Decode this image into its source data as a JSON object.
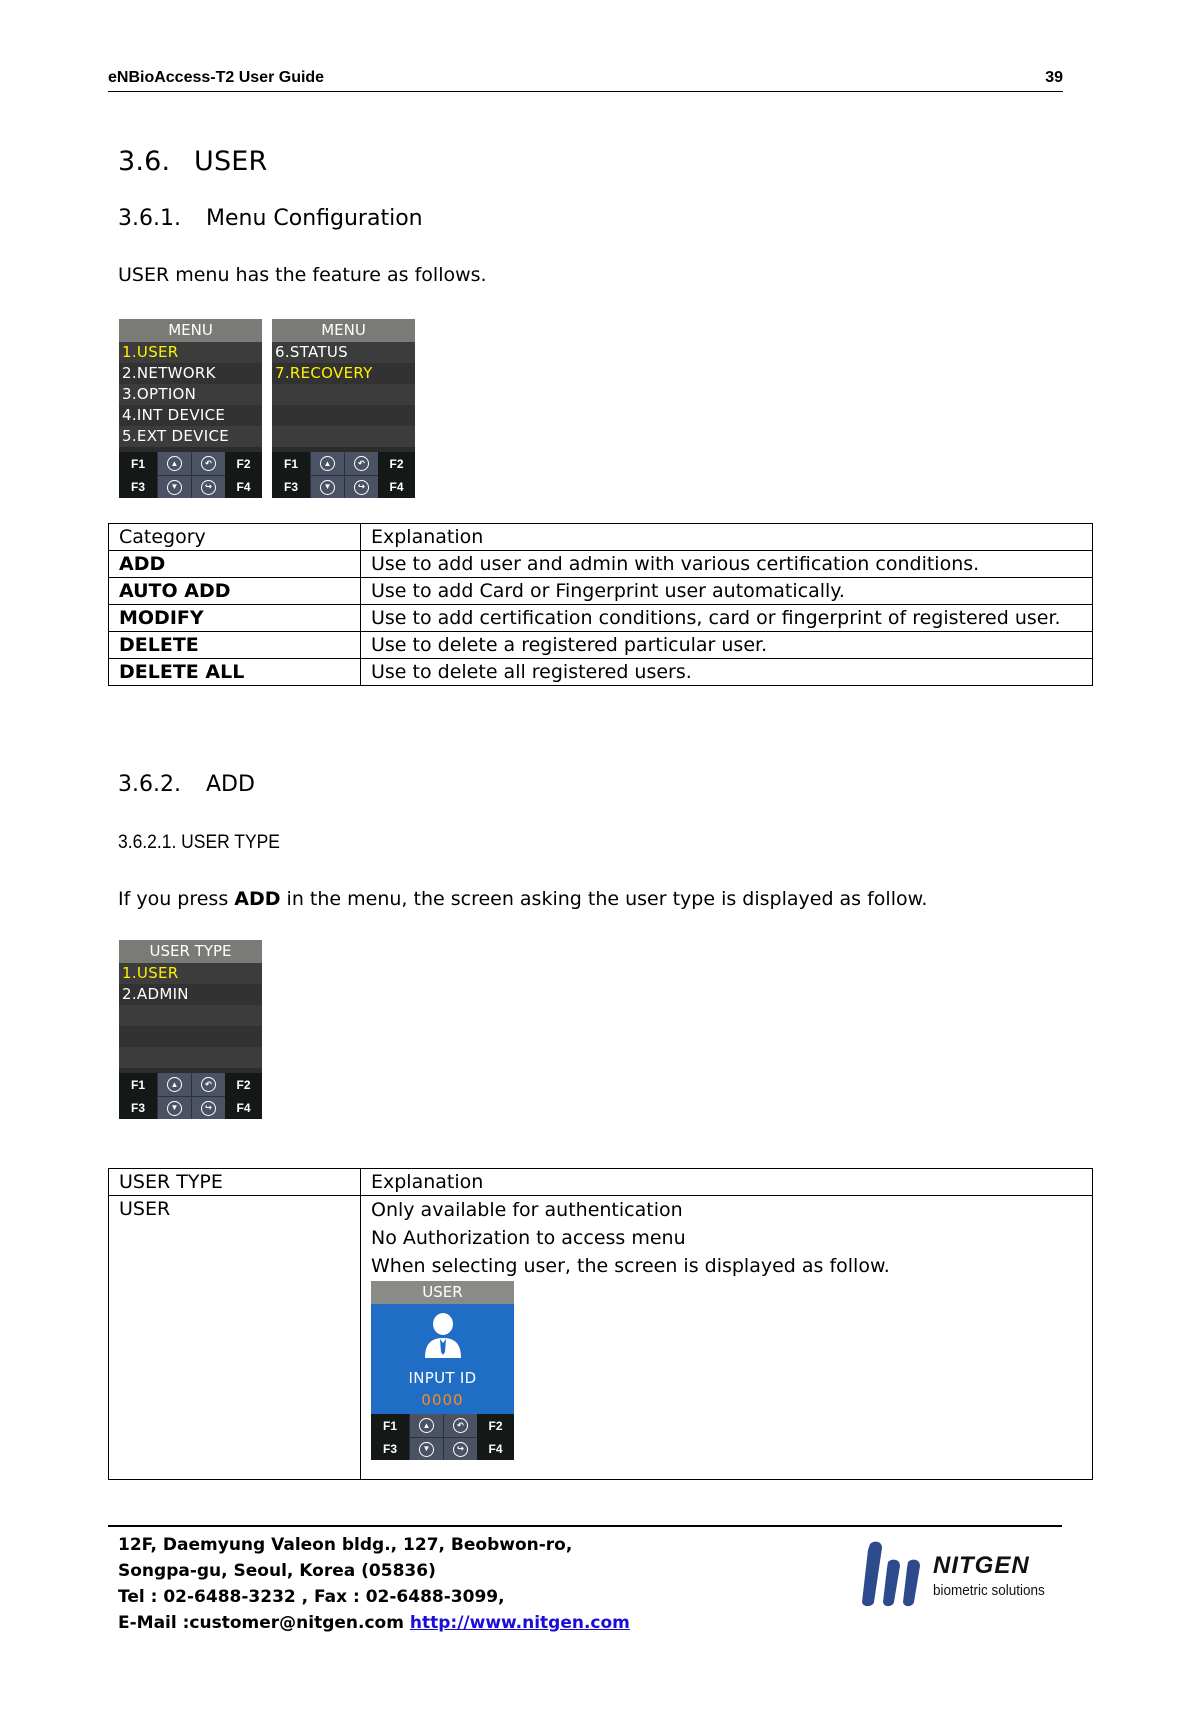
{
  "header": {
    "doc_title": "eNBioAccess-T2 User Guide",
    "page_number": "39"
  },
  "section": {
    "number": "3.6.",
    "title": "USER"
  },
  "subsection_menu": {
    "number": "3.6.1.",
    "title": "Menu Configuration",
    "intro": "USER menu has the feature as follows."
  },
  "device_menu_1": {
    "title": "MENU",
    "items": [
      {
        "label": "1.USER",
        "selected": true
      },
      {
        "label": "2.NETWORK",
        "selected": false
      },
      {
        "label": "3.OPTION",
        "selected": false
      },
      {
        "label": "4.INT DEVICE",
        "selected": false
      },
      {
        "label": "5.EXT DEVICE",
        "selected": false
      }
    ]
  },
  "device_menu_2": {
    "title": "MENU",
    "items": [
      {
        "label": "6.STATUS",
        "selected": false
      },
      {
        "label": "7.RECOVERY",
        "selected": true
      },
      {
        "label": "",
        "selected": false
      },
      {
        "label": "",
        "selected": false
      },
      {
        "label": "",
        "selected": false
      }
    ]
  },
  "keypad": {
    "f1": "F1",
    "f2": "F2",
    "f3": "F3",
    "f4": "F4",
    "up_icon": "▲",
    "back_icon": "↶",
    "down_icon": "▼",
    "enter_icon": "↪"
  },
  "menu_table": {
    "headers": [
      "Category",
      "Explanation"
    ],
    "rows": [
      [
        "ADD",
        "Use to add user and admin with various certification conditions."
      ],
      [
        "AUTO ADD",
        "Use to add Card or Fingerprint user automatically."
      ],
      [
        "MODIFY",
        "Use to add certification conditions, card or fingerprint of registered user."
      ],
      [
        "DELETE",
        "Use to delete a registered particular user."
      ],
      [
        "DELETE ALL",
        "Use to delete all registered users."
      ]
    ]
  },
  "subsection_add": {
    "number": "3.6.2.",
    "title": "ADD"
  },
  "subsubsection_user_type": {
    "title": "3.6.2.1. USER TYPE",
    "intro_before": "If you press ",
    "intro_bold": "ADD",
    "intro_after": " in the menu, the screen asking the user type is displayed as follow."
  },
  "device_user_type": {
    "title": "USER TYPE",
    "items": [
      {
        "label": "1.USER",
        "selected": true
      },
      {
        "label": "2.ADMIN",
        "selected": false
      },
      {
        "label": "",
        "selected": false
      },
      {
        "label": "",
        "selected": false
      },
      {
        "label": "",
        "selected": false
      }
    ]
  },
  "user_type_table": {
    "headers": [
      "USER TYPE",
      "Explanation"
    ],
    "rows": [
      {
        "type": "USER",
        "lines": [
          "Only available for authentication",
          "No Authorization to access menu",
          "When selecting user, the screen is displayed as follow."
        ]
      }
    ]
  },
  "device_user_input": {
    "title": "USER",
    "prompt": "INPUT ID",
    "value": "0000"
  },
  "footer": {
    "address_line1": "12F, Daemyung Valeon bldg., 127, Beobwon-ro,",
    "address_line2": "Songpa-gu, Seoul, Korea (05836)",
    "phone_line": "Tel : 02-6488-3232 , Fax : 02-6488-3099,",
    "email_label": "E-Mail :customer@nitgen.com ",
    "website": "http://www.nitgen.com"
  },
  "logo": {
    "brand": "NITGEN",
    "tagline": "biometric solutions",
    "color": "#2d4a8c"
  }
}
